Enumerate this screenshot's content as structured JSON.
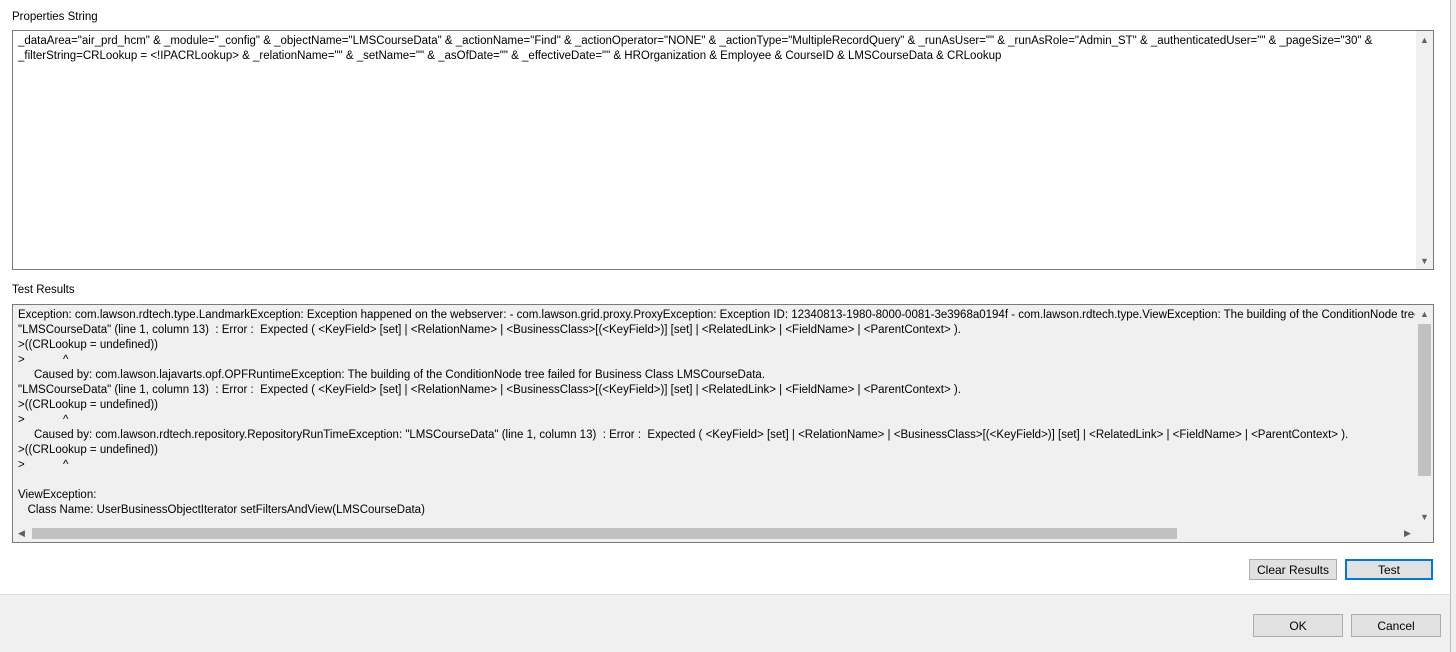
{
  "properties": {
    "label": "Properties String",
    "value": "_dataArea=\"air_prd_hcm\" & _module=\"_config\" & _objectName=\"LMSCourseData\" & _actionName=\"Find\" & _actionOperator=\"NONE\" & _actionType=\"MultipleRecordQuery\" & _runAsUser=\"\" & _runAsRole=\"Admin_ST\" & _authenticatedUser=\"\" & _pageSize=\"30\" & _filterString=CRLookup = <!IPACRLookup> & _relationName=\"\" & _setName=\"\" & _asOfDate=\"\" & _effectiveDate=\"\" & HROrganization & Employee & CourseID & LMSCourseData & CRLookup"
  },
  "results": {
    "label": "Test Results",
    "lines": [
      "Exception: com.lawson.rdtech.type.LandmarkException: Exception happened on the webserver: - com.lawson.grid.proxy.ProxyException: Exception ID: 12340813-1980-8000-0081-3e3968a0194f - com.lawson.rdtech.type.ViewException: The building of the ConditionNode tree failed for Business Class LMSCourseData.",
      "\"LMSCourseData\" (line 1, column 13)  : Error :  Expected ( <KeyField> [set] | <RelationName> | <BusinessClass>[(<KeyField>)] [set] | <RelatedLink> | <FieldName> | <ParentContext> ).",
      ">((CRLookup = undefined))",
      ">            ^",
      "     Caused by: com.lawson.lajavarts.opf.OPFRuntimeException: The building of the ConditionNode tree failed for Business Class LMSCourseData.",
      "\"LMSCourseData\" (line 1, column 13)  : Error :  Expected ( <KeyField> [set] | <RelationName> | <BusinessClass>[(<KeyField>)] [set] | <RelatedLink> | <FieldName> | <ParentContext> ).",
      ">((CRLookup = undefined))",
      ">            ^",
      "     Caused by: com.lawson.rdtech.repository.RepositoryRunTimeException: \"LMSCourseData\" (line 1, column 13)  : Error :  Expected ( <KeyField> [set] | <RelationName> | <BusinessClass>[(<KeyField>)] [set] | <RelatedLink> | <FieldName> | <ParentContext> ).",
      ">((CRLookup = undefined))",
      ">            ^",
      "",
      "ViewException:",
      "   Class Name: UserBusinessObjectIterator setFiltersAndView(LMSCourseData)"
    ]
  },
  "buttons": {
    "clear": "Clear Results",
    "test": "Test",
    "ok": "OK",
    "cancel": "Cancel"
  },
  "icons": {
    "scroll_up": "▲",
    "scroll_down": "▼",
    "scroll_left": "◀",
    "scroll_right": "▶"
  }
}
